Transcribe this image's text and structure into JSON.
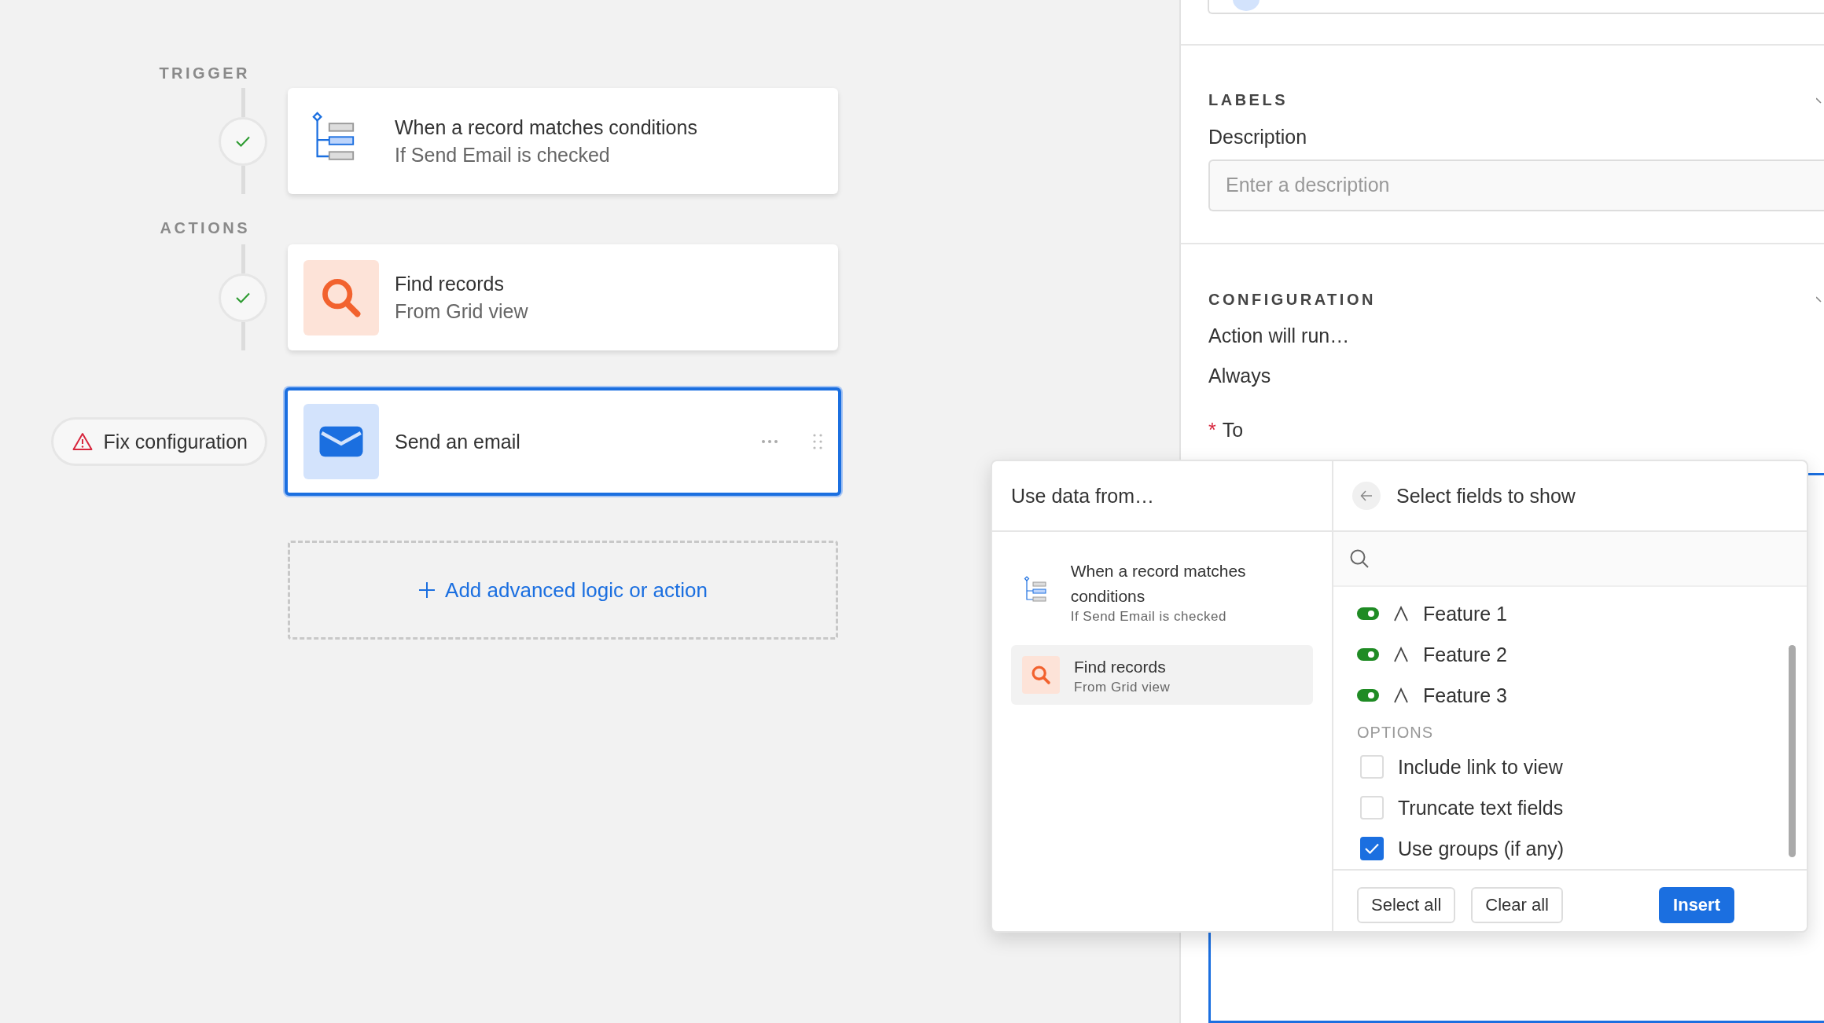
{
  "workflow": {
    "sections": [
      {
        "label": "TRIGGER",
        "steps": [
          {
            "kind": "conditions",
            "title": "When a record matches conditions",
            "subtitle": "If Send Email is checked",
            "complete": true,
            "selected": false
          }
        ]
      },
      {
        "label": "ACTIONS",
        "steps": [
          {
            "kind": "search",
            "title": "Find records",
            "subtitle": "From Grid view",
            "complete": true,
            "selected": false
          },
          {
            "kind": "email",
            "title": "Send an email",
            "complete": false,
            "status_label": "Fix configuration",
            "selected": true
          }
        ]
      }
    ],
    "add_action": "Add advanced logic or action"
  },
  "panel": {
    "labels": {
      "heading": "LABELS",
      "field_label": "Description",
      "placeholder": "Enter a description"
    },
    "configuration": {
      "heading": "CONFIGURATION",
      "run_label": "Action will run…",
      "run_value": "Always",
      "required_mark": "*",
      "to_label": "To"
    }
  },
  "picker": {
    "title": "Use data from…",
    "sources": [
      {
        "kind": "conditions",
        "title": "When a record matches conditions",
        "subtitle": "If Send Email is checked",
        "selected": false
      },
      {
        "kind": "search",
        "title": "Find records",
        "subtitle": "From Grid view",
        "selected": true
      }
    ],
    "fields_title": "Select fields to show",
    "fields": [
      {
        "name": "Feature 1",
        "on": true
      },
      {
        "name": "Feature 2",
        "on": true
      },
      {
        "name": "Feature 3",
        "on": true
      }
    ],
    "options_heading": "OPTIONS",
    "options": [
      {
        "label": "Include link to view",
        "checked": false
      },
      {
        "label": "Truncate text fields",
        "checked": false
      },
      {
        "label": "Use groups (if any)",
        "checked": true
      }
    ],
    "buttons": [
      {
        "label": "Select all",
        "kind": "secondary"
      },
      {
        "label": "Clear all",
        "kind": "secondary"
      },
      {
        "label": "Insert",
        "kind": "primary"
      }
    ]
  }
}
